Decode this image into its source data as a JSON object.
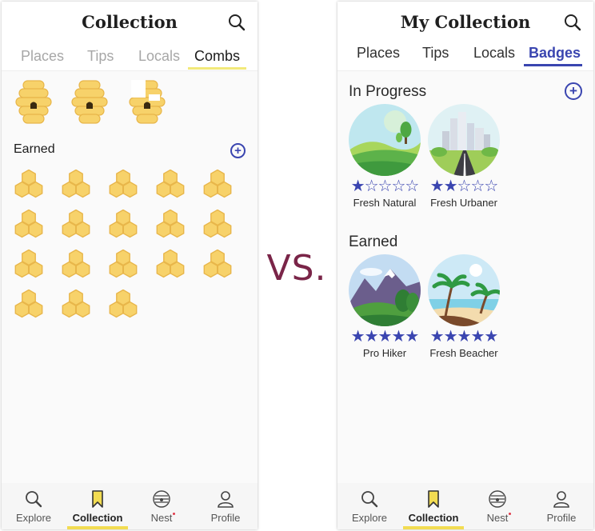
{
  "vs_label": "VS.",
  "left": {
    "title": "Collection",
    "tabs": [
      "Places",
      "Tips",
      "Locals",
      "Combs"
    ],
    "earned_label": "Earned",
    "add_symbol": "+",
    "top_comb_icons": [
      "honeycomb-hive-icon",
      "honeycomb-hive-icon",
      "honeycomb-hive-partial-icon"
    ],
    "earned_comb_count": 18
  },
  "right": {
    "title": "My Collection",
    "tabs": [
      "Places",
      "Tips",
      "Locals",
      "Badges"
    ],
    "in_progress_label": "In Progress",
    "earned_label": "Earned",
    "add_symbol": "+",
    "in_progress": [
      {
        "name": "Fresh Natural",
        "stars": "★☆☆☆☆",
        "rating": 1,
        "icon": "green-hills-badge-icon"
      },
      {
        "name": "Fresh Urbaner",
        "stars": "★★☆☆☆",
        "rating": 2,
        "icon": "city-road-badge-icon"
      }
    ],
    "earned": [
      {
        "name": "Pro Hiker",
        "stars": "★★★★★",
        "rating": 5,
        "icon": "mountain-badge-icon"
      },
      {
        "name": "Fresh Beacher",
        "stars": "★★★★★",
        "rating": 5,
        "icon": "beach-palm-badge-icon"
      }
    ]
  },
  "nav": {
    "explore": "Explore",
    "collection": "Collection",
    "nest": "Nest",
    "profile": "Profile"
  },
  "colors": {
    "accent": "#3a45b0",
    "honey": "#f7d26a",
    "honey_stroke": "#e8b64a",
    "highlight": "#f2dc52",
    "vs": "#7a2548"
  }
}
